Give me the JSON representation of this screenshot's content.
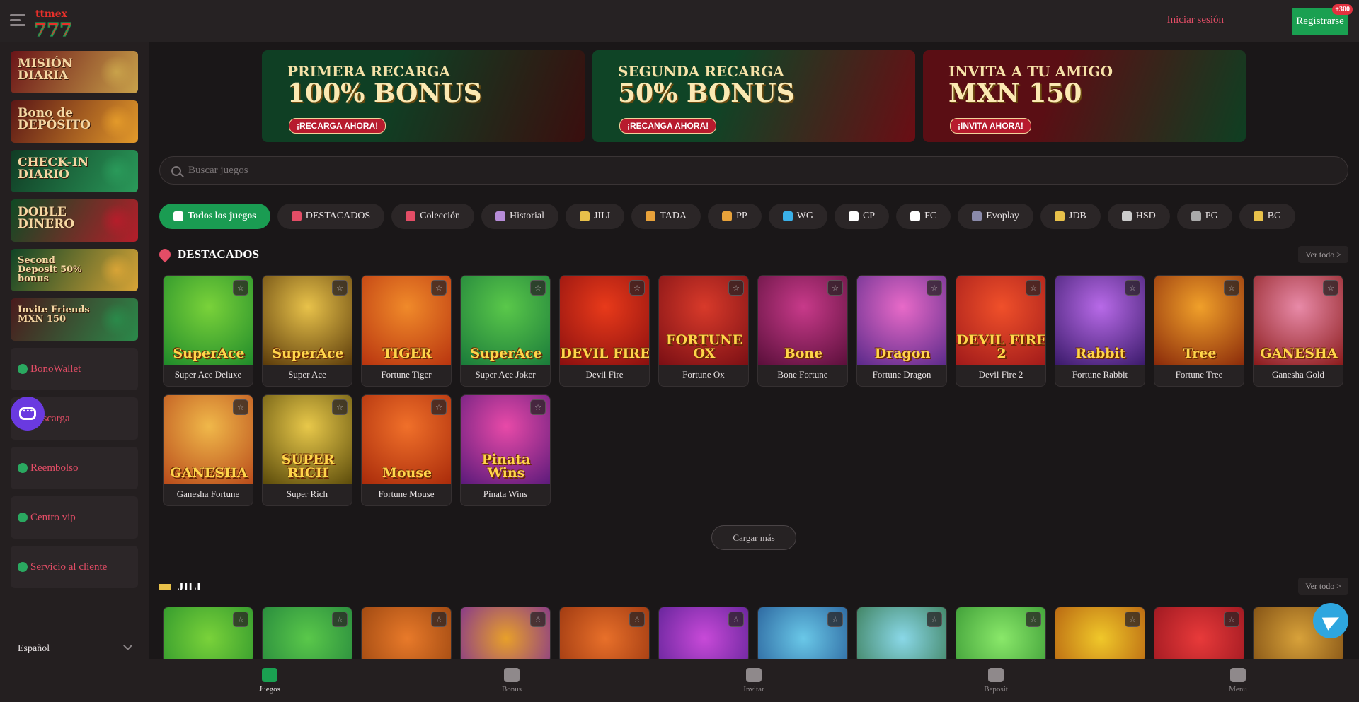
{
  "header": {
    "login_label": "Iniciar sesión",
    "register_label": "Registrarse",
    "register_badge": "+300",
    "logo_text": "ttmex 777"
  },
  "sidebar": {
    "promos": [
      {
        "label": "Misión Diaria",
        "text": "MISIÓN DIARIA",
        "bg": "#6a1418",
        "accent": "#c9a24a"
      },
      {
        "label": "Bono de Depósito",
        "text": "Bono de DEPÓSITO",
        "bg": "#5a1616",
        "accent": "#e39a2a"
      },
      {
        "label": "Check-in Diario",
        "text": "CHECK-IN DIARIO",
        "bg": "#103b24",
        "accent": "#2a9a5a"
      },
      {
        "label": "Doble Dinero",
        "text": "DOBLE DINERO",
        "bg": "#0e4a24",
        "accent": "#b61d2a"
      },
      {
        "label": "Second Deposit 50% bonus",
        "text": "Second Deposit 50% bonus",
        "bg": "#0f4426",
        "accent": "#d8a436"
      },
      {
        "label": "Invite Friends MXN 150",
        "text": "Invite Friends MXN 150",
        "bg": "#4a1a1c",
        "accent": "#2a8a4a"
      }
    ],
    "items": [
      {
        "label": "BonoWallet",
        "icon": "wallet-icon",
        "color": "#2aa860"
      },
      {
        "label": "Descarga",
        "icon": "download-icon",
        "color": "#2aa860"
      },
      {
        "label": "Reembolso",
        "icon": "refund-icon",
        "color": "#2aa860"
      },
      {
        "label": "Centro vip",
        "icon": "vip-icon",
        "color": "#2aa860"
      },
      {
        "label": "Servicio al cliente",
        "icon": "support-icon",
        "color": "#2aa860"
      }
    ],
    "language": "Español"
  },
  "banners": [
    {
      "line1": "PRIMERA RECARGA",
      "line2": "100% BONUS",
      "cta": "¡RECARGA AHORA!",
      "bg1": "#0f3f24",
      "bg2": "#3a0e0e"
    },
    {
      "line1": "SEGUNDA RECARGA",
      "line2": "50% BONUS",
      "cta": "¡RECANGA AHORA!",
      "bg1": "#0f4426",
      "bg2": "#6a0d14"
    },
    {
      "line1": "INVITA A TU AMIGO",
      "line2": "MXN 150",
      "cta": "¡INVITA AHORA!",
      "bg1": "#5a0e14",
      "bg2": "#0e3f22"
    }
  ],
  "search": {
    "placeholder": "Buscar juegos"
  },
  "categories": [
    {
      "label": "Todos los juegos",
      "active": true,
      "icon": "home-icon",
      "color": "#ffffff"
    },
    {
      "label": "DESTACADOS",
      "icon": "fire-icon",
      "color": "#e34d66"
    },
    {
      "label": "Colección",
      "icon": "collection-icon",
      "color": "#e34d66"
    },
    {
      "label": "Historial",
      "icon": "history-icon",
      "color": "#b68cd8"
    },
    {
      "label": "JILI",
      "icon": "jili-icon",
      "color": "#e8c14a"
    },
    {
      "label": "TADA",
      "icon": "tada-icon",
      "color": "#e8a23a"
    },
    {
      "label": "PP",
      "icon": "pp-icon",
      "color": "#e8a23a"
    },
    {
      "label": "WG",
      "icon": "wg-icon",
      "color": "#3ab0e8"
    },
    {
      "label": "CP",
      "icon": "cp-icon",
      "color": "#ffffff"
    },
    {
      "label": "FC",
      "icon": "fc-icon",
      "color": "#ffffff"
    },
    {
      "label": "Evoplay",
      "icon": "evoplay-icon",
      "color": "#8a8aaa"
    },
    {
      "label": "JDB",
      "icon": "jdb-icon",
      "color": "#e8c14a"
    },
    {
      "label": "HSD",
      "icon": "hsd-icon",
      "color": "#cccccc"
    },
    {
      "label": "PG",
      "icon": "pg-icon",
      "color": "#aaaaaa"
    },
    {
      "label": "BG",
      "icon": "bg-icon",
      "color": "#e8c14a"
    }
  ],
  "featured": {
    "title": "DESTACADOS",
    "see_all": "Ver todo >",
    "games": [
      {
        "name": "Super Ace Deluxe",
        "art": "SuperAce",
        "bg1": "#1f8a2a",
        "bg2": "#7ad23a"
      },
      {
        "name": "Super Ace",
        "art": "SuperAce",
        "bg1": "#5a3a0a",
        "bg2": "#e8c24a"
      },
      {
        "name": "Fortune Tiger",
        "art": "TIGER",
        "bg1": "#b8340f",
        "bg2": "#f08a2a"
      },
      {
        "name": "Super Ace Joker",
        "art": "SuperAce",
        "bg1": "#1a7a3a",
        "bg2": "#5ac84a"
      },
      {
        "name": "Devil Fire",
        "art": "DEVIL FIRE",
        "bg1": "#8a0f0f",
        "bg2": "#e83a1a"
      },
      {
        "name": "Fortune Ox",
        "art": "FORTUNE OX",
        "bg1": "#7a0f14",
        "bg2": "#d83a2a"
      },
      {
        "name": "Bone Fortune",
        "art": "Bone",
        "bg1": "#5a0f3a",
        "bg2": "#c83a8a"
      },
      {
        "name": "Fortune Dragon",
        "art": "Dragon",
        "bg1": "#5a2a8a",
        "bg2": "#e86ac8"
      },
      {
        "name": "Devil Fire 2",
        "art": "DEVIL FIRE 2",
        "bg1": "#a01a1a",
        "bg2": "#f0502a"
      },
      {
        "name": "Fortune Rabbit",
        "art": "Rabbit",
        "bg1": "#3a1a6a",
        "bg2": "#b86ae8"
      },
      {
        "name": "Fortune Tree",
        "art": "Tree",
        "bg1": "#8a2a0a",
        "bg2": "#f0a02a"
      },
      {
        "name": "Ganesha Gold",
        "art": "GANESHA",
        "bg1": "#8a1a1a",
        "bg2": "#e88aa8"
      },
      {
        "name": "Ganesha Fortune",
        "art": "GANESHA",
        "bg1": "#b84a1a",
        "bg2": "#f0b84a"
      },
      {
        "name": "Super Rich",
        "art": "SUPER RICH",
        "bg1": "#5a4a0a",
        "bg2": "#e8c84a"
      },
      {
        "name": "Fortune Mouse",
        "art": "Mouse",
        "bg1": "#a82a0a",
        "bg2": "#f0702a"
      },
      {
        "name": "Pinata Wins",
        "art": "Pinata Wins",
        "bg1": "#5a1a7a",
        "bg2": "#e84aa8"
      }
    ],
    "load_more": "Cargar más"
  },
  "jili": {
    "title": "JILI",
    "see_all": "Ver todo >",
    "games": [
      {
        "bg1": "#1f8a2a",
        "bg2": "#7ad23a"
      },
      {
        "bg1": "#1a7a3a",
        "bg2": "#5ac84a"
      },
      {
        "bg1": "#8a3a0a",
        "bg2": "#e87a2a"
      },
      {
        "bg1": "#6a1aa8",
        "bg2": "#e8a02a"
      },
      {
        "bg1": "#8a2a0a",
        "bg2": "#e8702a"
      },
      {
        "bg1": "#4a1a8a",
        "bg2": "#c84ad8"
      },
      {
        "bg1": "#1a4a8a",
        "bg2": "#6ac8e8"
      },
      {
        "bg1": "#2a6a3a",
        "bg2": "#8ad8e8"
      },
      {
        "bg1": "#2a8a2a",
        "bg2": "#8ae86a"
      },
      {
        "bg1": "#a84a0a",
        "bg2": "#f0c82a"
      },
      {
        "bg1": "#8a0f1a",
        "bg2": "#e83a3a"
      },
      {
        "bg1": "#6a3a0a",
        "bg2": "#d8a23a"
      }
    ]
  },
  "bottom_nav": [
    {
      "label": "Juegos",
      "icon": "gamepad-icon",
      "active": true
    },
    {
      "label": "Bonus",
      "icon": "gift-icon"
    },
    {
      "label": "Invitar",
      "icon": "invite-icon"
    },
    {
      "label": "Beposit",
      "icon": "moneybag-icon"
    },
    {
      "label": "Menu",
      "icon": "menu-icon"
    }
  ]
}
